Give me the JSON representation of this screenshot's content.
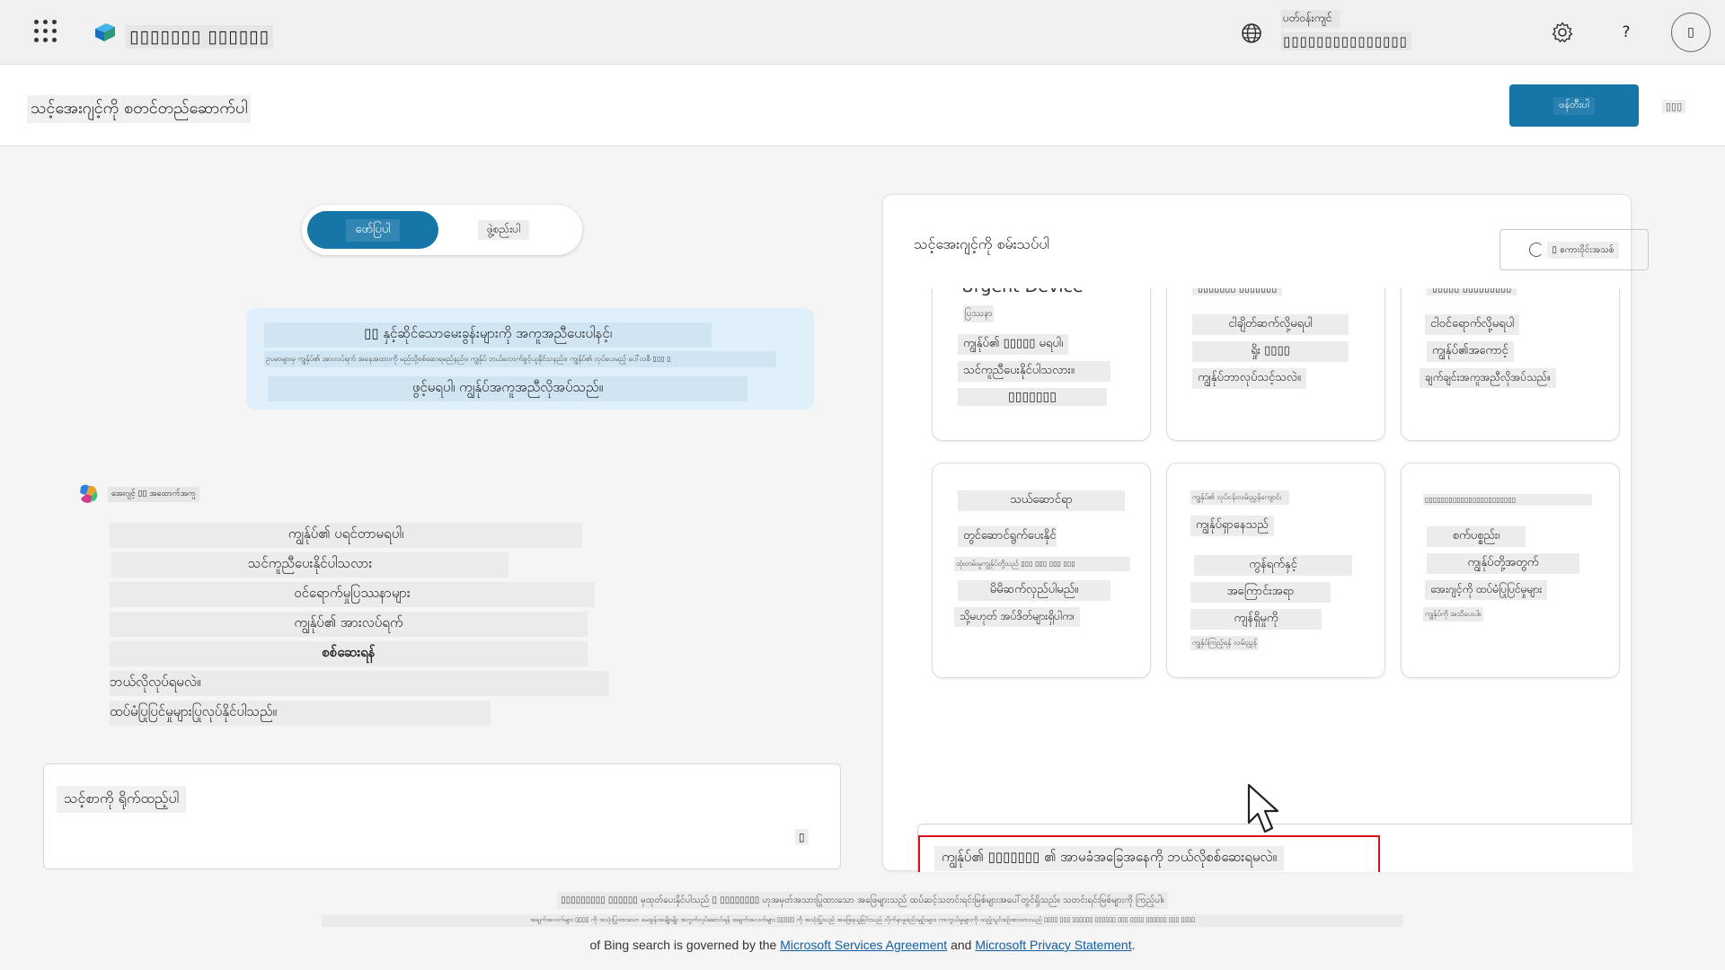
{
  "app": {
    "title": "▯▯▯▯▯▯▯ ▯▯▯▯▯▯",
    "environment_label": "ပတ်ဝန်းကျင်",
    "environment_name": "▯▯▯▯▯▯▯▯▯▯▯▯▯▯▯",
    "settings_icon": "gear-icon",
    "help_label": "?",
    "avatar_initials": "▯"
  },
  "header": {
    "page_title": "သင့်အေးဂျင့်ကို စတင်တည်ဆောက်ပါ",
    "create_button": "ဖန်တီးပါ",
    "more_button": "▯▯▯"
  },
  "toggle": {
    "describe": "ဖော်ပြပါ",
    "configure": "ဖွဲ့စည်းပါ"
  },
  "intro": {
    "line1": "▯▯ နှင့်ဆိုင်သောမေးခွန်းများကို အကူအညီပေးပါနင့်၊",
    "line2": "ဥပမာများမှ ကျွန်ုပ်၏ အားလပ်ရက် အနေအထားကို မည်သို့စစ်ဆေးရမည်နည်း။ ကျွန်ုပ် ဘယ်လောက်ခွင့်ယူနိုင်သနည်း။ ကျွန်ုပ်၏ လုပ်ပေးမည့် ပေါ်လစီ ▯▯▯ ▯",
    "line3": "ဖွင့်မရပါ၊ ကျွန်ုပ်အကူအညီလိုအပ်သည်။"
  },
  "assistant": {
    "name": "အေးဂျင့် ▯▯ အထောက်အကူ",
    "reply_lines": [
      "ကျွန်ုပ်၏ ပရင်တာမရပါ၊",
      "သင်ကူညီပေးနိုင်ပါသလား",
      "ဝင်ရောက်မှုပြဿနာများ",
      "ကျွန်ုပ်၏ အားလပ်ရက်",
      "စစ်ဆေးရန်",
      "ဘယ်လိုလုပ်ရမလဲ။",
      "ထပ်မံပြုပြင်မှုများပြုလုပ်နိုင်ပါသည်။"
    ]
  },
  "left_input": {
    "placeholder": "သင့်စာကို ရိုက်ထည့်ပါ",
    "mic_label": "▯"
  },
  "right_pane": {
    "title": "သင့်အေးဂျင့်ကို စမ်းသပ်ပါ",
    "refresh_label": "▯ စကားဝိုင်းအသစ်",
    "cards": [
      {
        "lines": [
          "Urgent Device",
          "ပြဿနာ",
          "ကျွန်ုပ်၏ ▯▯▯▯▯ မရပါ၊",
          "သင်ကူညီပေးနိုင်ပါသလား။",
          "▯▯▯▯▯▯▯"
        ]
      },
      {
        "lines": [
          "▯▯▯▯▯▯▯ ▯▯▯▯▯▯▯",
          "ငါချိတ်ဆက်လို့မရပါ",
          "ရှိုး ▯▯▯▯",
          "ကျွန်ုပ်ဘာလုပ်သင့်သလဲ။"
        ]
      },
      {
        "lines": [
          "▯▯▯▯▯ ▯▯▯▯▯▯▯▯▯",
          "ငါဝင်ရောက်လို့မရပါ",
          "ကျွန်ုပ်၏အကောင့်",
          "ချက်ချင်းအကူအညီလိုအပ်သည်။"
        ]
      },
      {
        "lines": [
          "သယ်ဆောင်ရာ",
          "တွင်ဆောင်ရွက်ပေးနိုင်",
          "ထုံးတမ်းမှုကျွန်ုပ်တို့သည် ▯▯▯ ▯▯▯ ▯▯▯ ▯▯▯",
          "မိမိဆက်လှည်ပါမည်။",
          "သို့မဟုတ် အပ်ဒိတ်များရှိပါက၊"
        ]
      },
      {
        "lines": [
          "ကျွန်ုပ်၏ လုပ်ငန်းလမ်းညွှန်ကျောင်း",
          "ကျွန်ုပ်ရှာနေသည်",
          "ကွန်ရက်နှင့်",
          "အကြောင်းအရာ",
          "ကျန်ရှိမှုကို",
          "ကျွန်ုပ်ကြည့်ရန် လမ်းညွှန်"
        ]
      },
      {
        "lines": [
          "▯▯▯▯▯▯▯▯▯▯▯▯▯▯▯▯▯▯▯▯▯▯▯",
          "စက်ပစ္စည်း၊",
          "ကျွန်ုပ်တို့အတွက်",
          "အေးဂျင့်ကို ထပ်မံပြုပြင်မှုများ",
          "ကျွန်ုပ်ကို အသိပေးပါ။"
        ]
      }
    ],
    "chat_query": "ကျွန်ုပ်၏ ▯▯▯▯▯▯▯ ၏ အာမခံအခြေအနေကို ဘယ်လိုစစ်ဆေးရမလဲ။",
    "chat_sub": "▯▯▯▯▯▯▯",
    "send_icon": "send-icon"
  },
  "footer": {
    "line1": "▯▯▯▯▯▯▯▯▯ ▯▯▯▯▯▯ မှထုတ်ပေးနိုင်ပါသည် ▯ ▯▯▯▯▯▯▯▯ ဟုအမှတ်အသားပြုထားသော အဖြေများသည် ထပ်ဆင့်သတင်းရင်းမြစ်များအပေါ်တွင်ရှိသည်။ သတင်းရင်းမြစ်များကို ကြည့်ပါ။",
    "line2": "အချက်အလက်များ ▯▯▯▯ ကို အသုံးပြုထားသော မေးခွန်းအမျိုးမျိုး အတွက်လုပ်ဆောင်ရန် အချက်အလက်များ ▯▯▯▯▯ ကို အသုံးပြုသည် အဖြေရယူခြင်းသည် လိုက်နာမှုစည်းမျဉ်းများ၊ ကာကွယ်မှုများကို ထည့်သွင်းစဉ်းစားထားသည် ▯▯▯▯ ▯▯▯ ▯▯▯▯▯▯ ▯▯▯▯▯▯ ▯▯▯ ▯▯▯▯ ▯▯▯▯▯▯ ▯▯▯ ▯▯▯▯",
    "line3_pre": "of Bing search is governed by the",
    "link1": "Microsoft Services Agreement",
    "line3_mid": "and",
    "link2": "Microsoft Privacy Statement",
    "line3_end": "."
  },
  "colors": {
    "accent": "#1776a8",
    "highlight_box": "#d9151b",
    "intro_bg": "#dff0fb",
    "link": "#0f5fa6"
  }
}
